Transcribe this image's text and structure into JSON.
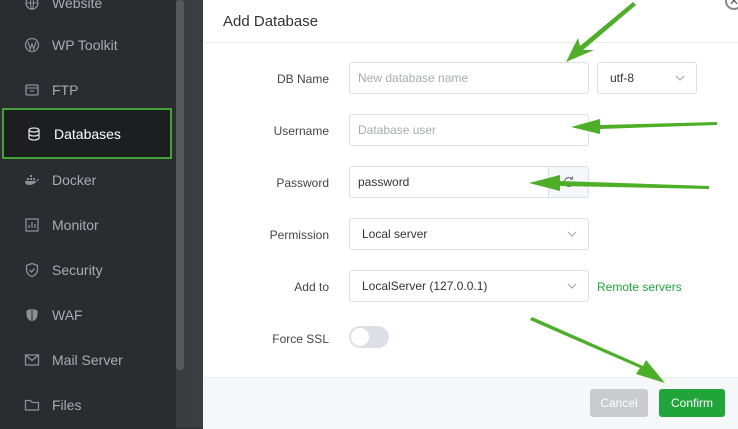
{
  "sidebar": {
    "items": [
      {
        "label": "Website",
        "icon": "globe-icon"
      },
      {
        "label": "WP Toolkit",
        "icon": "wordpress-icon"
      },
      {
        "label": "FTP",
        "icon": "ftp-icon"
      },
      {
        "label": "Databases",
        "icon": "database-icon",
        "active": true
      },
      {
        "label": "Docker",
        "icon": "docker-icon"
      },
      {
        "label": "Monitor",
        "icon": "monitor-icon"
      },
      {
        "label": "Security",
        "icon": "shield-icon"
      },
      {
        "label": "WAF",
        "icon": "waf-shield-icon"
      },
      {
        "label": "Mail Server",
        "icon": "mail-icon"
      },
      {
        "label": "Files",
        "icon": "folder-icon"
      }
    ]
  },
  "dialog": {
    "title": "Add Database",
    "fields": {
      "db_name": {
        "label": "DB Name",
        "placeholder": "New database name",
        "charset": "utf-8"
      },
      "username": {
        "label": "Username",
        "placeholder": "Database user"
      },
      "password": {
        "label": "Password",
        "value": "password"
      },
      "permission": {
        "label": "Permission",
        "value": "Local server"
      },
      "add_to": {
        "label": "Add to",
        "value": "LocalServer (127.0.0.1)",
        "link": "Remote servers"
      },
      "force_ssl": {
        "label": "Force SSL",
        "enabled": false
      }
    },
    "buttons": {
      "cancel": "Cancel",
      "confirm": "Confirm"
    }
  },
  "colors": {
    "accent": "#20a53a",
    "annotation_arrow": "#4caf27",
    "sidebar_bg": "#2a2c2f"
  }
}
